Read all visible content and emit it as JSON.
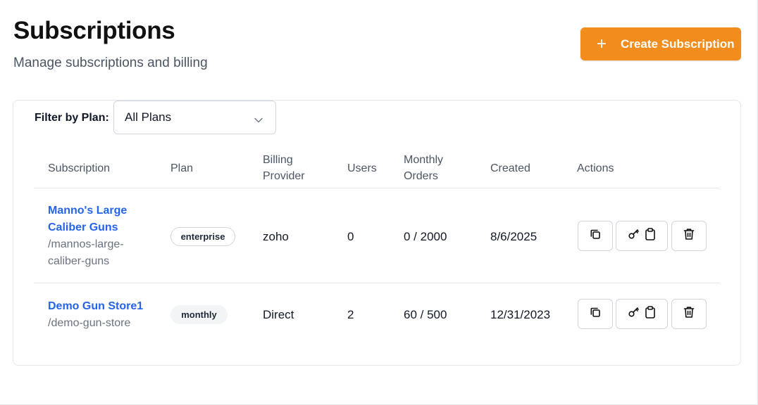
{
  "header": {
    "title": "Subscriptions",
    "subtitle": "Manage subscriptions and billing",
    "create_button": "Create Subscription"
  },
  "filter": {
    "label": "Filter by Plan:",
    "selected": "All Plans"
  },
  "table": {
    "columns": {
      "subscription": "Subscription",
      "plan": "Plan",
      "billing_1": "Billing",
      "billing_2": "Provider",
      "users": "Users",
      "orders_1": "Monthly",
      "orders_2": "Orders",
      "created": "Created",
      "actions": "Actions"
    },
    "rows": [
      {
        "name_1": "Manno's Large",
        "name_2": "Caliber Guns",
        "slug_1": "/mannos-large-",
        "slug_2": "caliber-guns",
        "plan": "enterprise",
        "billing_provider": "zoho",
        "users": "0",
        "monthly_orders": "0 / 2000",
        "created": "8/6/2025"
      },
      {
        "name_1": "Demo Gun Store1",
        "slug_1": "/demo-gun-store",
        "plan": "monthly",
        "billing_provider": "Direct",
        "users": "2",
        "monthly_orders": "60 / 500",
        "created": "12/31/2023"
      }
    ],
    "action_icons": [
      "copy-icon",
      "key-icon",
      "clipboard-icon",
      "trash-icon"
    ]
  },
  "colors": {
    "accent": "#f28c1c",
    "link": "#2563eb",
    "muted": "#6b7280"
  }
}
